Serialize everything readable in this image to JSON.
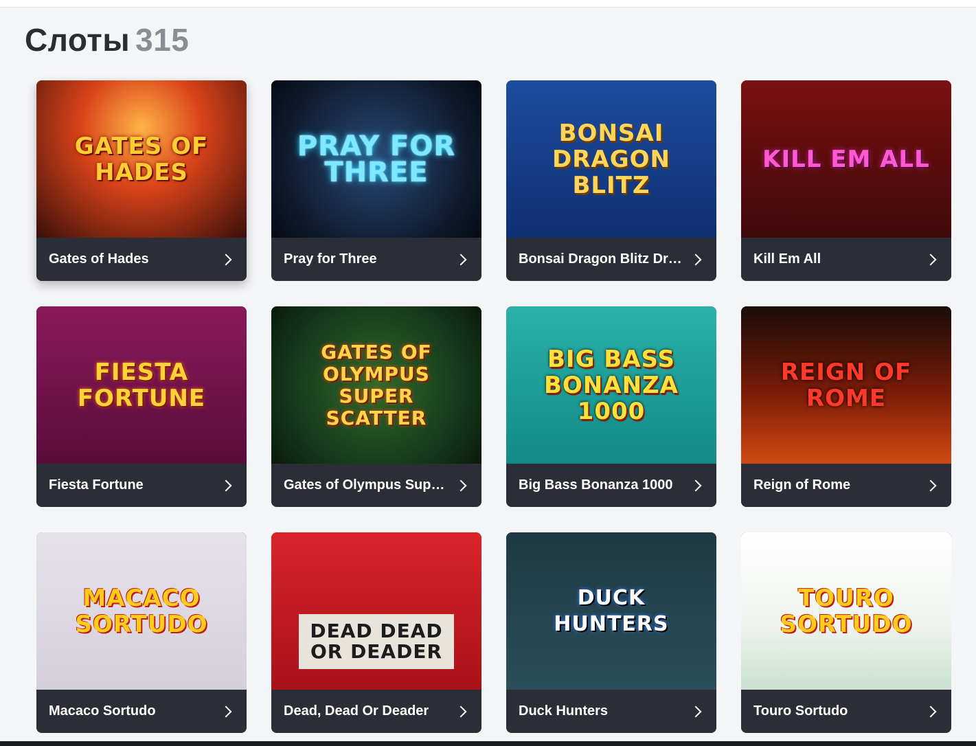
{
  "header": {
    "title": "Слоты",
    "count": "315"
  },
  "games": [
    {
      "name": "Gates of Hades",
      "art_text": "Gates of Hades"
    },
    {
      "name": "Pray for Three",
      "art_text": "Pray for Three"
    },
    {
      "name": "Bonsai Dragon Blitz Dream Drop",
      "art_text": "Bonsai Dragon Blitz"
    },
    {
      "name": "Kill Em All",
      "art_text": "Kill Em All"
    },
    {
      "name": "Fiesta Fortune",
      "art_text": "Fiesta Fortune"
    },
    {
      "name": "Gates of Olympus Super Scatter",
      "art_text": "Gates of Olympus Super Scatter"
    },
    {
      "name": "Big Bass Bonanza 1000",
      "art_text": "Big Bass Bonanza 1000"
    },
    {
      "name": "Reign of Rome",
      "art_text": "Reign of Rome"
    },
    {
      "name": "Macaco Sortudo",
      "art_text": "Macaco Sortudo"
    },
    {
      "name": "Dead, Dead Or Deader",
      "art_text": "Dead Dead or Deader"
    },
    {
      "name": "Duck Hunters",
      "art_text": "Duck Hunters"
    },
    {
      "name": "Touro Sortudo",
      "art_text": "Touro Sortudo"
    }
  ]
}
